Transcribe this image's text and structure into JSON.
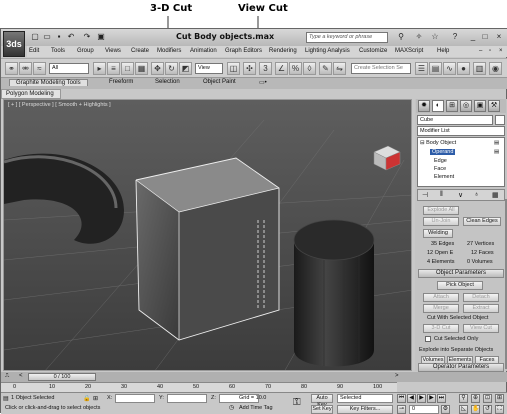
{
  "callouts": {
    "left": "3-D Cut",
    "right": "View Cut"
  },
  "window": {
    "title": "Cut Body objects.max",
    "logo": "3ds"
  },
  "search": {
    "placeholder": "Type a keyword or phrase"
  },
  "menu": [
    "Edit",
    "Tools",
    "Group",
    "Views",
    "Create",
    "Modifiers",
    "Animation",
    "Graph Editors",
    "Rendering",
    "Lighting Analysis",
    "Customize",
    "MAXScript",
    "Help"
  ],
  "toolbar": {
    "filter_value": "All",
    "view_value": "View",
    "selection_set_placeholder": "Create Selection Se"
  },
  "ribbon": {
    "tabs": [
      "Graphite Modeling Tools",
      "Freeform",
      "Selection",
      "Object Paint"
    ],
    "panel": "Polygon Modeling"
  },
  "viewport": {
    "label": "[ + ] [ Perspective ] [ Smooth + Highlights ]"
  },
  "command_panel": {
    "object_name": "Cube",
    "modifier_list": "Modifier List",
    "stack": [
      "Body Object",
      "Operand",
      "Edge",
      "Face",
      "Element"
    ],
    "buttons_top": [
      "Explode All",
      "Un-Join",
      "Clean Edges",
      "Welding"
    ],
    "stats": {
      "edges": "35 Edges",
      "vertices": "27 Vertices",
      "open_edges": "12 Open E",
      "faces": "12 Faces",
      "elements": "4 Elements",
      "volumes": "0 Volumes"
    },
    "rollout_object_params": "Object Parameters",
    "pick_object": "Pick Object",
    "attach": "Attach",
    "detach": "Detach",
    "merge": "Merge",
    "extract": "Extract",
    "cut_with_label": "Cut With Selected Object",
    "cut_3d": "3-D Cut",
    "view_cut": "View Cut",
    "cut_selected_only": "Cut Selected Only",
    "explode_label": "Explode into Separate Objects",
    "volumes_btn": "Volumes",
    "elements_btn": "Elements",
    "faces_btn": "Faces",
    "rollout_operator_params": "Operator Parameters"
  },
  "timeline": {
    "frame": "0 / 100",
    "ticks": [
      "0",
      "10",
      "20",
      "30",
      "40",
      "50",
      "60",
      "70",
      "80",
      "90",
      "100"
    ]
  },
  "status": {
    "selected": "1 Object Selected",
    "prompt": "Click or click-and-drag to select objects",
    "x_label": "X:",
    "y_label": "Y:",
    "z_label": "Z:",
    "grid": "Grid = 10.0",
    "add_time_tag": "Add Time Tag",
    "auto_key": "Auto Key",
    "set_key": "Set Key",
    "selected_dropdown": "Selected",
    "key_filters": "Key Filters...",
    "frame_value": "0"
  },
  "colors": {
    "viewport_bg": "#5a5a5a",
    "selection_blue": "#2d5ca8",
    "ui_gray": "#c8c8c8"
  }
}
